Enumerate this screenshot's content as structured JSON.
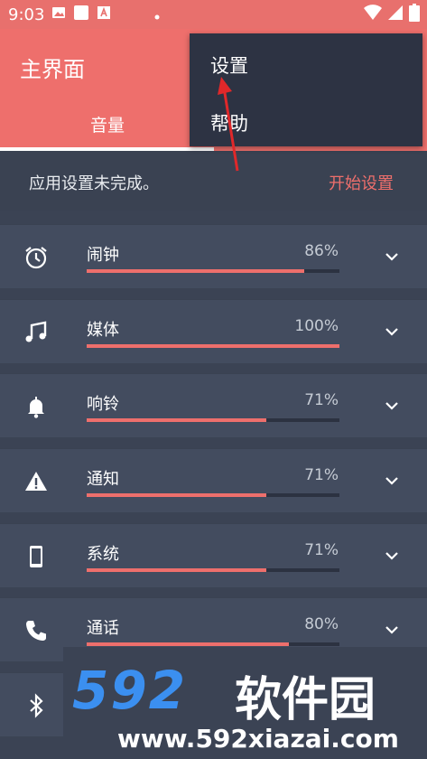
{
  "status_bar": {
    "time": "9:03"
  },
  "toolbar": {
    "title": "主界面",
    "tab_label": "音量"
  },
  "menu": {
    "items": [
      "设置",
      "帮助"
    ]
  },
  "banner": {
    "message": "应用设置未完成。",
    "action": "开始设置"
  },
  "colors": {
    "accent": "#ee6f6c",
    "background": "#3b4354",
    "row": "#434c5f",
    "menu": "#2d3343"
  },
  "streams": [
    {
      "label": "闹钟",
      "percent_text": "86%",
      "level": 0.86,
      "icon": "alarm-icon"
    },
    {
      "label": "媒体",
      "percent_text": "100%",
      "level": 1.0,
      "icon": "music-note-icon"
    },
    {
      "label": "响铃",
      "percent_text": "71%",
      "level": 0.71,
      "icon": "bell-icon"
    },
    {
      "label": "通知",
      "percent_text": "71%",
      "level": 0.71,
      "icon": "warning-icon"
    },
    {
      "label": "系统",
      "percent_text": "71%",
      "level": 0.71,
      "icon": "phone-device-icon"
    },
    {
      "label": "通话",
      "percent_text": "80%",
      "level": 0.8,
      "icon": "phone-call-icon"
    },
    {
      "icon": "bluetooth-icon"
    }
  ],
  "watermark": {
    "brand": "592",
    "brand_cn": "软件园",
    "url": "www.592xiazai.com"
  }
}
